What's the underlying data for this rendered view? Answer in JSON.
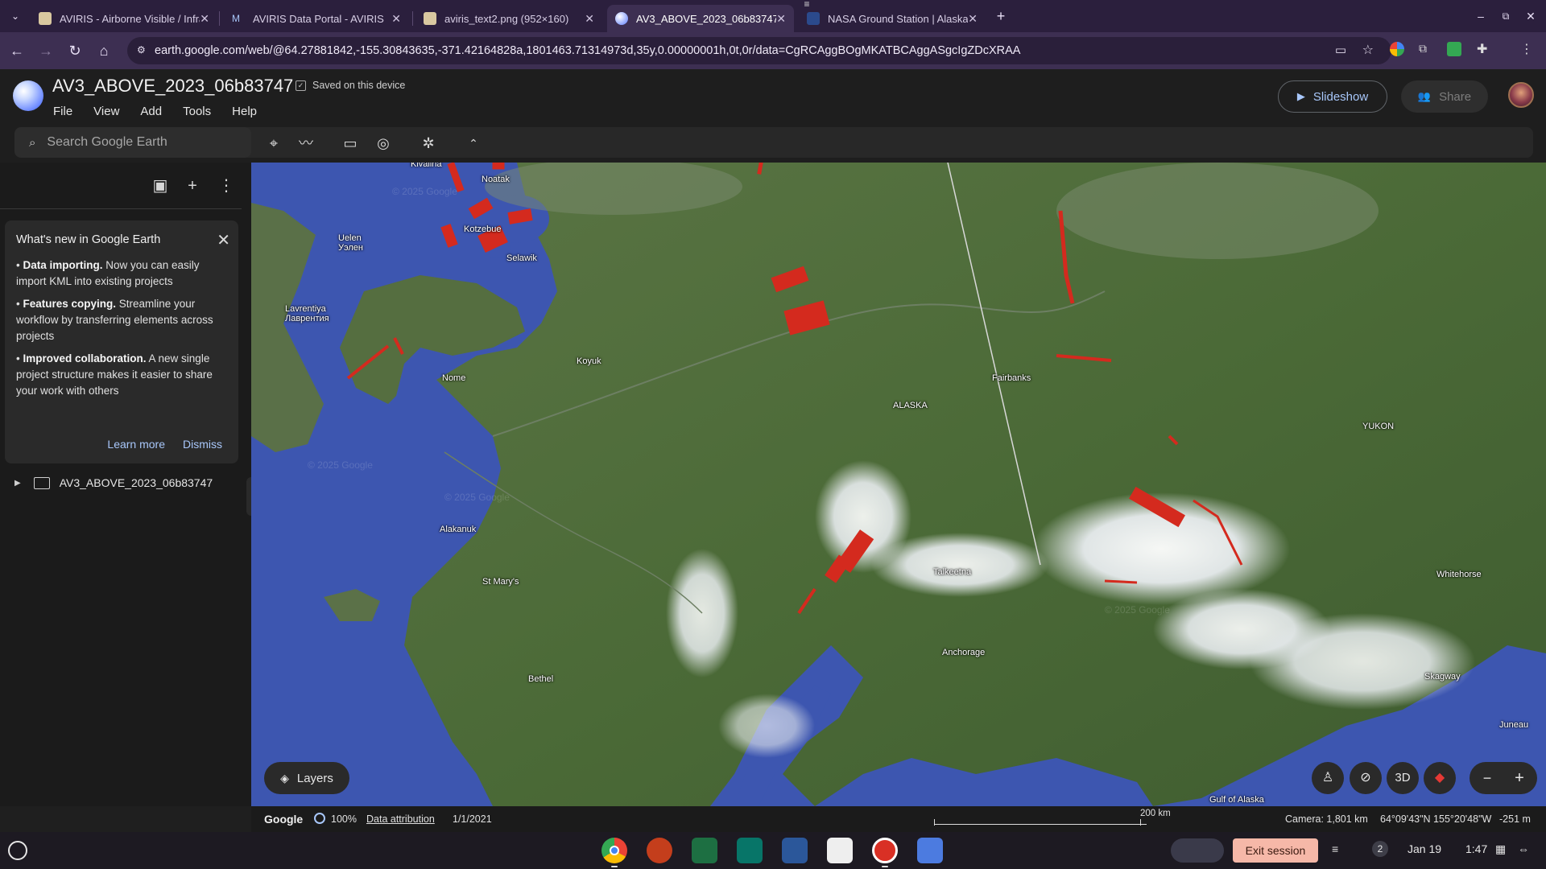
{
  "browser": {
    "tabs": [
      {
        "title": "AVIRIS - Airborne Visible / Infra",
        "active": false
      },
      {
        "title": "AVIRIS Data Portal - AVIRIS",
        "active": false
      },
      {
        "title": "aviris_text2.png (952×160)",
        "active": false
      },
      {
        "title": "AV3_ABOVE_2023_06b83747 ·",
        "active": true
      },
      {
        "title": "NASA Ground Station | Alaska",
        "active": false
      }
    ],
    "url": "earth.google.com/web/@64.27881842,-155.30843635,-371.42164828a,1801463.71314973d,35y,0.00000001h,0t,0r/data=CgRCAggBOgMKATBCAggASgcIgZDcXRAA"
  },
  "app": {
    "project_title": "AV3_ABOVE_2023_06b83747",
    "saved_status": "Saved on this device",
    "menu": [
      "File",
      "View",
      "Add",
      "Tools",
      "Help"
    ],
    "slideshow_label": "Slideshow",
    "share_label": "Share",
    "search_placeholder": "Search Google Earth"
  },
  "whats_new": {
    "title": "What's new in Google Earth",
    "items": [
      {
        "bold": "Data importing.",
        "text": " Now you can easily import KML into existing projects"
      },
      {
        "bold": "Features copying.",
        "text": " Streamline your workflow by transferring elements across projects"
      },
      {
        "bold": "Improved collaboration.",
        "text": " A new single project structure makes it easier to share your work with others"
      }
    ],
    "learn_more": "Learn more",
    "dismiss": "Dismiss"
  },
  "project_tree": {
    "folder": "AV3_ABOVE_2023_06b83747"
  },
  "map": {
    "places": [
      "Kivalina",
      "Noatak",
      "Kotzebue",
      "Selawik",
      "Uelen\nУэлен",
      "Lavrentiya\nЛаврентия",
      "Koyuk",
      "Nome",
      "Fairbanks",
      "ALASKA",
      "YUKON",
      "Alakanuk",
      "St Mary's",
      "Talkeetna",
      "Anchorage",
      "Bethel",
      "Whitehorse",
      "Skagway",
      "Juneau",
      "Gulf of Alaska"
    ],
    "watermarks": [
      "© 2025 Google",
      "© 2025 Google",
      "© 2025 Google",
      "© 2025 Google"
    ],
    "layers_label": "Layers",
    "view_3d": "3D"
  },
  "status": {
    "brand": "Google",
    "load": "100%",
    "attribution": "Data attribution",
    "imagery_date": "1/1/2021",
    "scale": "200 km",
    "camera": "Camera: 1,801 km",
    "coords": "64°09'43\"N 155°20'48\"W",
    "elevation": "-251 m"
  },
  "shelf": {
    "exit_label": "Exit session",
    "notifications": "2",
    "date": "Jan 19",
    "time": "1:47"
  },
  "colors": {
    "accent": "#a8c7fa",
    "flightline": "#d42a1e",
    "ocean": "#3d56b0",
    "land": "#4d6b3a"
  }
}
